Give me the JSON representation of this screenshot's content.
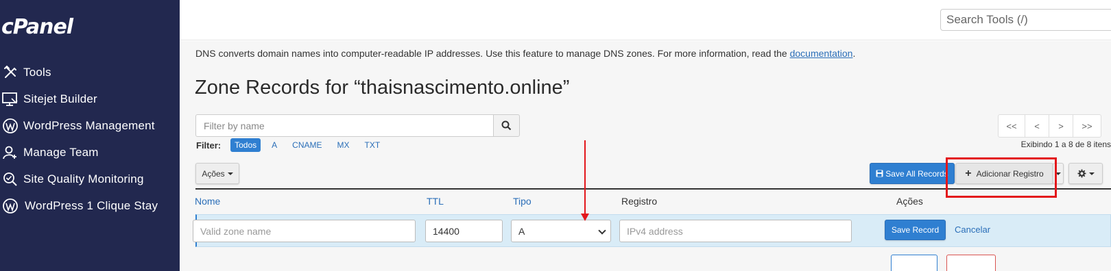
{
  "sidebar": {
    "logo": "cPanel",
    "items": [
      {
        "label": "Tools",
        "icon": "tools-icon"
      },
      {
        "label": "Sitejet Builder",
        "icon": "monitor-icon"
      },
      {
        "label": "WordPress Management",
        "icon": "wordpress-icon"
      },
      {
        "label": "Manage Team",
        "icon": "user-add-icon"
      },
      {
        "label": "Site Quality Monitoring",
        "icon": "search-check-icon"
      },
      {
        "label": "WordPress 1 Clique Stay",
        "icon": "wordpress-icon"
      }
    ]
  },
  "topbar": {
    "search_placeholder": "Search Tools (/)"
  },
  "intro": {
    "text": "DNS converts domain names into computer-readable IP addresses. Use this feature to manage DNS zones. For more information, read the ",
    "link": "documentation",
    "end": "."
  },
  "page_title": "Zone Records for “thaisnascimento.online”",
  "filter": {
    "placeholder": "Filter by name",
    "label": "Filter:",
    "pills": [
      "Todos",
      "A",
      "CNAME",
      "MX",
      "TXT"
    ],
    "active": "Todos"
  },
  "pager": {
    "buttons": [
      "<<",
      "<",
      ">",
      ">>"
    ],
    "info": "Exibindo 1 a 8 de 8 itens"
  },
  "toolbar": {
    "acoes": "Ações",
    "save_all": "Save All Records",
    "add": "Adicionar Registro"
  },
  "table": {
    "headers": {
      "nome": "Nome",
      "ttl": "TTL",
      "tipo": "Tipo",
      "registro": "Registro",
      "acoes": "Ações"
    }
  },
  "edit_row": {
    "name_placeholder": "Valid zone name",
    "ttl": "14400",
    "type": "A",
    "record_placeholder": "IPv4 address",
    "save": "Save Record",
    "cancel": "Cancelar"
  },
  "colors": {
    "sidebar_bg": "#22284f",
    "primary": "#2f7fd1",
    "link": "#2a6eb8",
    "annotation": "#e3161b",
    "edit_row_bg": "#d9ecf7"
  }
}
